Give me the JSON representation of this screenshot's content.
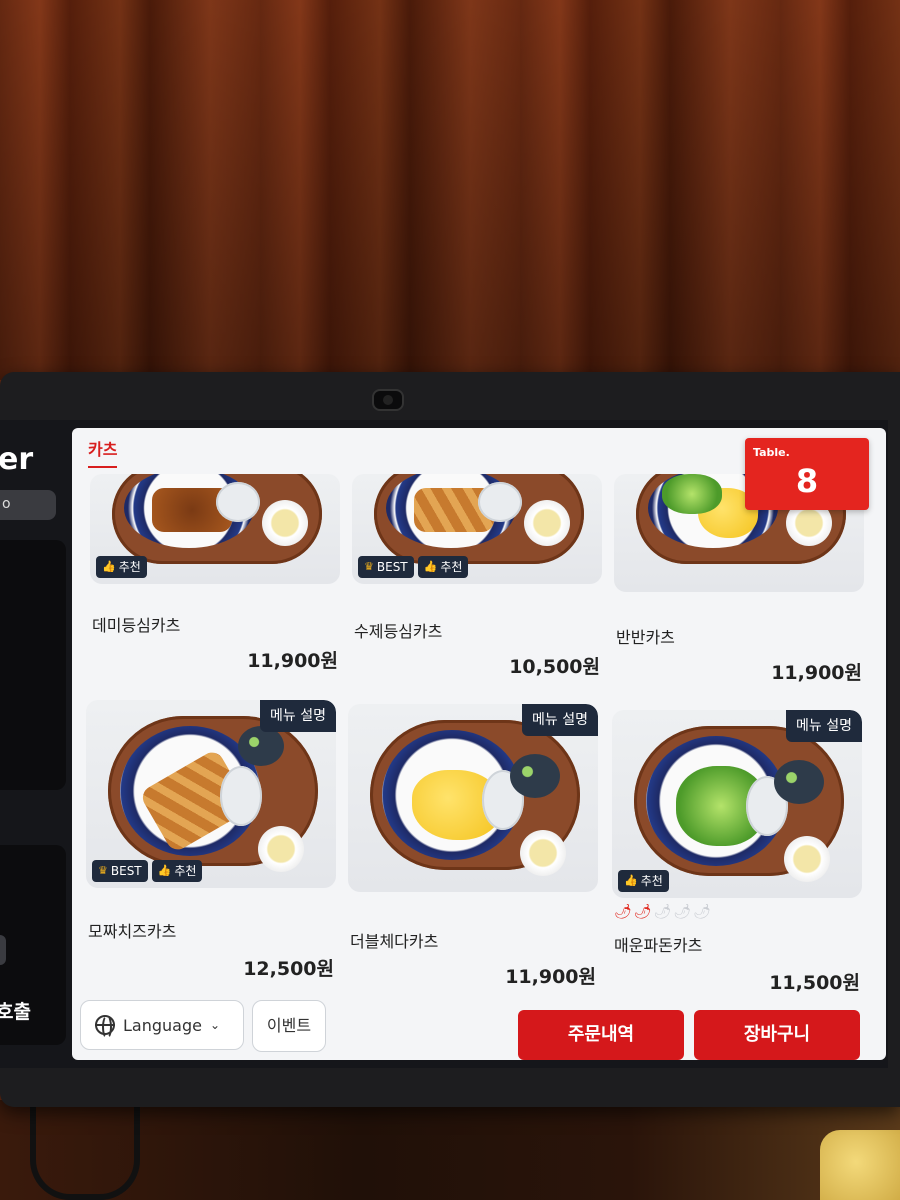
{
  "sidebar": {
    "title": "er",
    "pill": "o",
    "call_label": "호출"
  },
  "category_tab": "카츠",
  "table": {
    "label": "Table.",
    "number": "8"
  },
  "menu_items": [
    {
      "name": "데미등심카츠",
      "price": "11,900원",
      "badges": [
        "추천"
      ],
      "has_desc_button": false
    },
    {
      "name": "수제등심카츠",
      "price": "10,500원",
      "badges": [
        "BEST",
        "추천"
      ],
      "has_desc_button": false
    },
    {
      "name": "반반카츠",
      "price": "11,900원",
      "badges": [],
      "has_desc_button": false
    },
    {
      "name": "모짜치즈카츠",
      "price": "12,500원",
      "badges": [
        "BEST",
        "추천"
      ],
      "has_desc_button": true,
      "desc_label": "메뉴 설명"
    },
    {
      "name": "더블체다카츠",
      "price": "11,900원",
      "badges": [],
      "has_desc_button": true,
      "desc_label": "메뉴 설명"
    },
    {
      "name": "매운파돈카츠",
      "price": "11,500원",
      "badges": [
        "추천"
      ],
      "has_desc_button": true,
      "desc_label": "메뉴 설명",
      "spice_level": 2,
      "spice_max": 5
    }
  ],
  "bottom_bar": {
    "language_label": "Language",
    "event_label": "이벤트",
    "order_history_label": "주문내역",
    "cart_label": "장바구니"
  },
  "colors": {
    "accent_red": "#d5181b",
    "badge_navy": "#1f2a3c",
    "screen_bg": "#f4f5f7"
  }
}
